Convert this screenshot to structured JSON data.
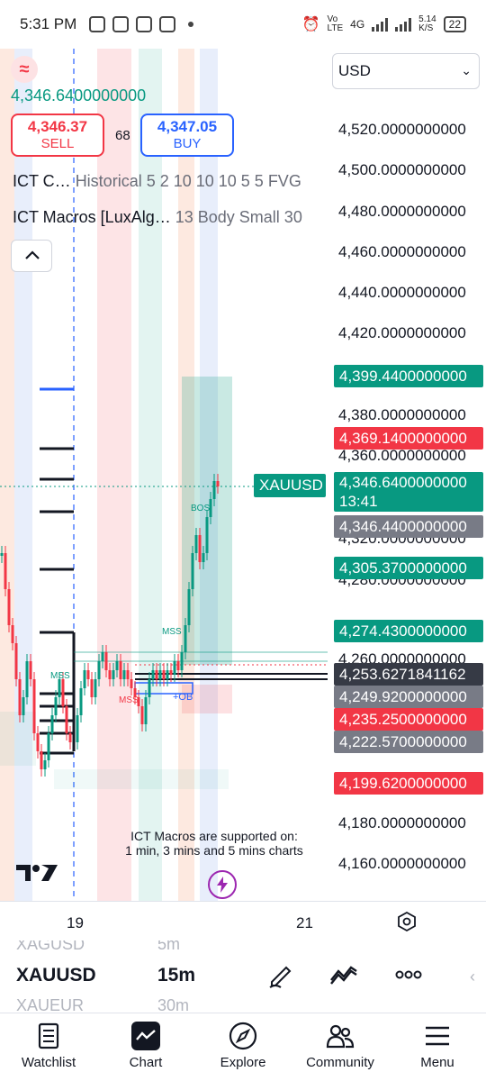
{
  "status_bar": {
    "time": "5:31 PM",
    "net_speed": "5.14\nK/S",
    "battery": "22",
    "network": "4G",
    "volte": "Vo\nLTE"
  },
  "top": {
    "last_price": "4,346.6400000000",
    "sell": {
      "price": "4,346.37",
      "label": "SELL"
    },
    "buy": {
      "price": "4,347.05",
      "label": "BUY"
    },
    "spread": "68",
    "indicators": [
      {
        "name": "ICT C…",
        "params": "Historical 5 2 10 10 10 5 5 FVG"
      },
      {
        "name": "ICT Macros [LuxAlg…",
        "params": "13 Body Small 30"
      }
    ],
    "currency": "USD"
  },
  "price_axis": {
    "ticks": [
      "4,520.0000000000",
      "4,500.0000000000",
      "4,480.0000000000",
      "4,460.0000000000",
      "4,440.0000000000",
      "4,420.0000000000",
      "4,380.0000000000",
      "4,360.0000000000",
      "4,320.0000000000",
      "4,280.0000000000",
      "4,260.0000000000",
      "4,180.0000000000",
      "4,160.0000000000"
    ],
    "tags": [
      {
        "value": "4,399.4400000000",
        "color": "#089981"
      },
      {
        "value": "4,369.1400000000",
        "color": "#f23645"
      },
      {
        "value": "4,346.6400000000",
        "sub": "13:41",
        "color": "#089981"
      },
      {
        "value": "4,346.4400000000",
        "color": "#787b86"
      },
      {
        "value": "4,305.3700000000",
        "color": "#089981"
      },
      {
        "value": "4,274.4300000000",
        "color": "#089981"
      },
      {
        "value": "4,253.6271841162",
        "color": "#363a45"
      },
      {
        "value": "4,249.9200000000",
        "color": "#787b86"
      },
      {
        "value": "4,235.2500000000",
        "color": "#f23645"
      },
      {
        "value": "4,222.5700000000",
        "color": "#787b86"
      },
      {
        "value": "4,199.6200000000",
        "color": "#f23645"
      }
    ]
  },
  "chart": {
    "symbol_tag": "XAUUSD",
    "labels": {
      "bos": "BOS",
      "mss1": "MSS",
      "mss2": "MSS",
      "mss3": "MSS",
      "ob": "+OB"
    },
    "macro_note_1": "ICT Macros are supported on:",
    "macro_note_2": "1 min, 3 mins and 5 mins charts"
  },
  "time_axis": {
    "labels": [
      "19",
      "21"
    ]
  },
  "picker": {
    "above_symbol": "XAGUSD",
    "above_interval": "5m",
    "symbol": "XAUUSD",
    "interval": "15m",
    "below_symbol": "XAUEUR",
    "below_interval": "30m"
  },
  "nav": [
    {
      "label": "Watchlist",
      "icon": "watchlist-icon"
    },
    {
      "label": "Chart",
      "icon": "chart-icon"
    },
    {
      "label": "Explore",
      "icon": "compass-icon"
    },
    {
      "label": "Community",
      "icon": "community-icon"
    },
    {
      "label": "Menu",
      "icon": "menu-icon"
    }
  ],
  "colors": {
    "up": "#089981",
    "down": "#f23645",
    "buy": "#2962ff",
    "macro": "#9c27b0"
  }
}
